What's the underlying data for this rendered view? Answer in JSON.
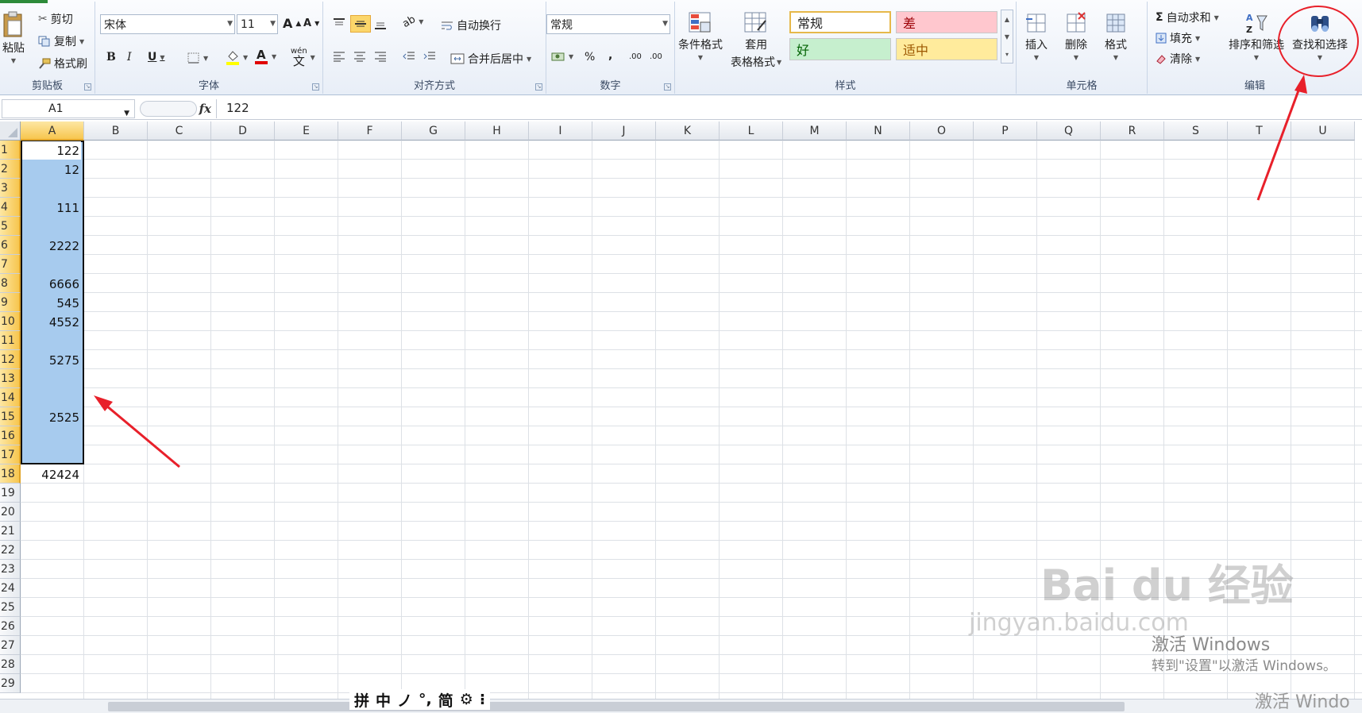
{
  "clipboard": {
    "paste": "粘贴",
    "cut": "剪切",
    "copy": "复制",
    "format_painter": "格式刷",
    "label": "剪贴板"
  },
  "font": {
    "name": "宋体",
    "size": "11",
    "grow": "A",
    "shrink": "A",
    "bold": "B",
    "italic": "I",
    "underline": "U",
    "wen": "wén",
    "label": "字体"
  },
  "alignment": {
    "wrap": "自动换行",
    "merge": "合并后居中",
    "label": "对齐方式"
  },
  "number": {
    "format": "常规",
    "percent": "%",
    "comma": ",",
    "inc": ".00",
    "dec": ".00",
    "label": "数字"
  },
  "styles": {
    "conditional": "条件格式",
    "table_fmt_1": "套用",
    "table_fmt_2": "表格格式",
    "normal": "常规",
    "bad": "差",
    "good": "好",
    "neutral": "适中",
    "label": "样式",
    "colors": {
      "normal_border": "#e6b84a",
      "bad_bg": "#ffc7ce",
      "bad_fg": "#9c0006",
      "good_bg": "#c6efce",
      "good_fg": "#006100",
      "neutral_bg": "#ffeb9c",
      "neutral_fg": "#9c5700"
    }
  },
  "cells_group": {
    "insert": "插入",
    "delete": "删除",
    "format": "格式",
    "label": "单元格"
  },
  "editing": {
    "autosum": "自动求和",
    "fill": "填充",
    "clear": "清除",
    "sort": "排序和筛选",
    "find": "查找和选择",
    "label": "编辑",
    "sigma": "Σ"
  },
  "formula_bar": {
    "name_box": "A1",
    "fx": "fx",
    "content": "122"
  },
  "columns": [
    "A",
    "B",
    "C",
    "D",
    "E",
    "F",
    "G",
    "H",
    "I",
    "J",
    "K",
    "L",
    "M",
    "N",
    "O",
    "P",
    "Q",
    "R",
    "S",
    "T",
    "U"
  ],
  "rows": [
    "1",
    "2",
    "3",
    "4",
    "5",
    "6",
    "7",
    "8",
    "9",
    "10",
    "11",
    "12",
    "13",
    "14",
    "15",
    "16",
    "17",
    "18",
    "19",
    "20",
    "21",
    "22",
    "23",
    "24",
    "25",
    "26",
    "27",
    "28",
    "29"
  ],
  "column_a_values": [
    "122",
    "12",
    "",
    "111",
    "",
    "2222",
    "",
    "6666",
    "545",
    "4552",
    "",
    "5275",
    "",
    "",
    "2525",
    "",
    "",
    "42424"
  ],
  "ime": {
    "glyphs": [
      "拼",
      "中",
      "ノ",
      "°,",
      "简",
      "⚙",
      "⁝"
    ]
  },
  "watermark": {
    "logo": "Bai du 经验",
    "url": "jingyan.baidu.com"
  },
  "activation": {
    "line1": "激活 Windows",
    "line2": "转到\"设置\"以激活 Windows。",
    "line3": "激活 Windo"
  },
  "annotation": {
    "highlight_color": "#e8202a"
  }
}
